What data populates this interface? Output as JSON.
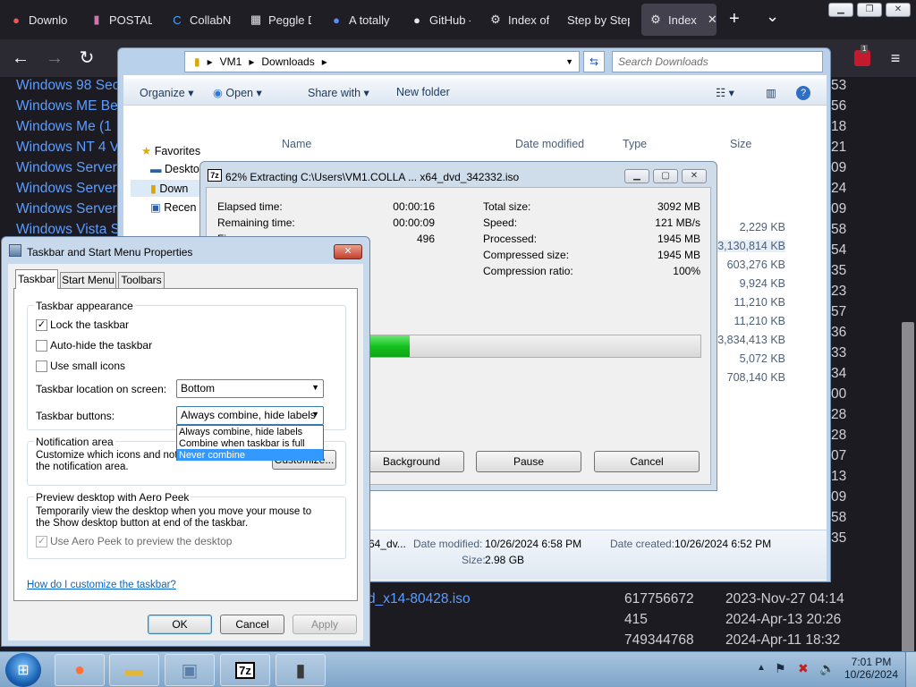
{
  "browser": {
    "tabs": [
      {
        "icon": "firefox-download-icon",
        "label": "Downlo",
        "glyph": "⬇"
      },
      {
        "icon": "postal-icon",
        "label": "POSTAL",
        "glyph": "🐾"
      },
      {
        "icon": "collab-icon",
        "label": "CollabN",
        "glyph": "C"
      },
      {
        "icon": "peggle-icon",
        "label": "Peggle D",
        "glyph": "▦"
      },
      {
        "icon": "people-icon",
        "label": "A totally",
        "glyph": "👥"
      },
      {
        "icon": "github-icon",
        "label": "GitHub -",
        "glyph": "●"
      },
      {
        "icon": "index-icon",
        "label": "Index of",
        "glyph": "⚙"
      },
      {
        "icon": "step-icon",
        "label": "Step by Step",
        "glyph": ""
      },
      {
        "icon": "index-active-icon",
        "label": "Index",
        "glyph": "⚙"
      }
    ],
    "new_tab": "+",
    "tab_list": "⌄",
    "notification_count": "1"
  },
  "background_list": {
    "left_items": [
      "Windows 98 Sec",
      "Windows ME Be",
      "Windows Me (1",
      "Windows NT 4 V",
      "Windows Server",
      "Windows Server",
      "Windows Server",
      "Windows Vista S"
    ],
    "right_numbers": [
      "53",
      "56",
      "18",
      "21",
      "09",
      "24",
      "09",
      "58",
      "54",
      "35",
      "23",
      "57",
      "36",
      "33",
      "34",
      "00",
      "28",
      "28",
      "07",
      "13",
      "09",
      "58",
      "35"
    ],
    "bottom_rows": [
      {
        "name": "d_x14-80428.iso",
        "size": "617756672",
        "date": "2023-Nov-27 04:14"
      },
      {
        "name": "",
        "size": "415",
        "date": "2024-Apr-13 20:26"
      },
      {
        "name": "",
        "size": "749344768",
        "date": "2024-Apr-11 18:32"
      }
    ]
  },
  "explorer": {
    "breadcrumb": [
      "VM1",
      "Downloads"
    ],
    "search_placeholder": "Search Downloads",
    "toolbar": {
      "organize": "Organize",
      "open": "Open",
      "share": "Share with",
      "new_folder": "New folder"
    },
    "columns": {
      "name": "Name",
      "date": "Date modified",
      "type": "Type",
      "size": "Size"
    },
    "nav": {
      "favorites": "Favorites",
      "desktop": "Deskto",
      "downloads": "Down",
      "recent": "Recen"
    },
    "sizes": [
      "2,229 KB",
      "3,130,814 KB",
      "603,276 KB",
      "9,924 KB",
      "11,210 KB",
      "11,210 KB",
      "3,834,413 KB",
      "5,072 KB",
      "708,140 KB"
    ],
    "details": {
      "name": "x64_dv...",
      "modified_label": "Date modified:",
      "modified": "10/26/2024 6:58 PM",
      "created_label": "Date created:",
      "created": "10/26/2024 6:52 PM",
      "size_label": "Size:",
      "size": "2.98 GB"
    }
  },
  "sevenzip": {
    "title": "62% Extracting C:\\Users\\VM1.COLLA ... x64_dvd_342332.iso",
    "progress": 0.62,
    "left": [
      {
        "label": "Elapsed time:",
        "value": "00:00:16"
      },
      {
        "label": "Remaining time:",
        "value": "00:00:09"
      },
      {
        "label": "Fi",
        "value": "496"
      }
    ],
    "right": [
      {
        "label": "Total size:",
        "value": "3092 MB"
      },
      {
        "label": "Speed:",
        "value": "121 MB/s"
      },
      {
        "label": "Processed:",
        "value": "1945 MB"
      },
      {
        "label": "Compressed size:",
        "value": "1945 MB"
      },
      {
        "label": "Compression ratio:",
        "value": "100%"
      }
    ],
    "buttons": {
      "background": "Background",
      "pause": "Pause",
      "cancel": "Cancel"
    }
  },
  "props": {
    "title": "Taskbar and Start Menu Properties",
    "tabs": [
      "Taskbar",
      "Start Menu",
      "Toolbars"
    ],
    "appearance_header": "Taskbar appearance",
    "lock": "Lock the taskbar",
    "autohide": "Auto-hide the taskbar",
    "small_icons": "Use small icons",
    "location_label": "Taskbar location on screen:",
    "location_value": "Bottom",
    "buttons_label": "Taskbar buttons:",
    "buttons_value": "Always combine, hide labels",
    "dropdown_options": [
      "Always combine, hide labels",
      "Combine when taskbar is full",
      "Never combine"
    ],
    "notif_header": "Notification area",
    "notif_text": "Customize which icons and notifications appear in the notification area.",
    "customize": "Customize...",
    "peek_header": "Preview desktop with Aero Peek",
    "peek_text": "Temporarily view the desktop when you move your mouse to the Show desktop button at end of the taskbar.",
    "peek_check": "Use Aero Peek to preview the desktop",
    "help_link": "How do I customize the taskbar?",
    "ok": "OK",
    "cancel": "Cancel",
    "apply": "Apply"
  },
  "taskbar": {
    "time": "7:01 PM",
    "date": "10/26/2024"
  },
  "colors": {
    "progress": "#14c21f",
    "link": "#0066cc",
    "selection": "#3399ff"
  }
}
